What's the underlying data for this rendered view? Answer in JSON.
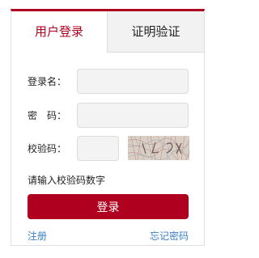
{
  "tabs": {
    "login": "用户登录",
    "certificate": "证明验证"
  },
  "form": {
    "username_label": "登录名：",
    "password_label": "密　码：",
    "captcha_label": "校验码：",
    "username_value": "",
    "password_value": "",
    "captcha_value": "",
    "hint": "请输入校验码数字"
  },
  "actions": {
    "login_button": "登录",
    "register_link": "注册",
    "forgot_link": "忘记密码"
  },
  "colors": {
    "accent": "#b0001f",
    "link": "#3b7fc4"
  }
}
